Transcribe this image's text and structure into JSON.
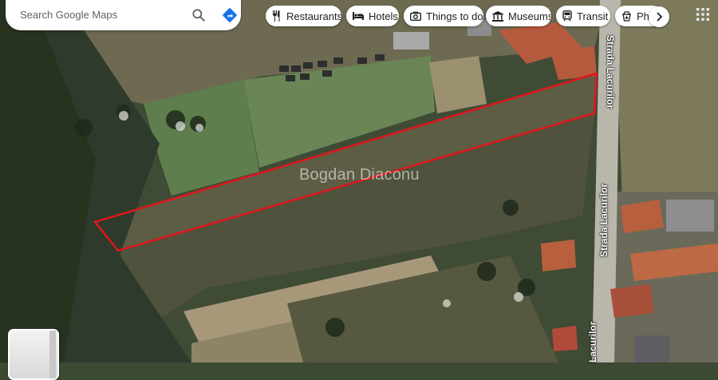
{
  "search": {
    "placeholder": "Search Google Maps"
  },
  "chips": [
    {
      "label": "Restaurants",
      "icon": "fork-knife-icon"
    },
    {
      "label": "Hotels",
      "icon": "bed-icon"
    },
    {
      "label": "Things to do",
      "icon": "camera-icon"
    },
    {
      "label": "Museums",
      "icon": "museum-icon"
    },
    {
      "label": "Transit",
      "icon": "train-icon"
    },
    {
      "label": "Pharmacies",
      "icon": "pharmacy-icon"
    }
  ],
  "map": {
    "watermark": "Bogdan Diaconu",
    "street_label_top": "Strada Lacurilor",
    "street_label_mid": "Strada Lacurilor",
    "street_label_bottom": "Lacurilor",
    "parcel_outline_color": "#e0161b",
    "view_mode": "satellite"
  }
}
